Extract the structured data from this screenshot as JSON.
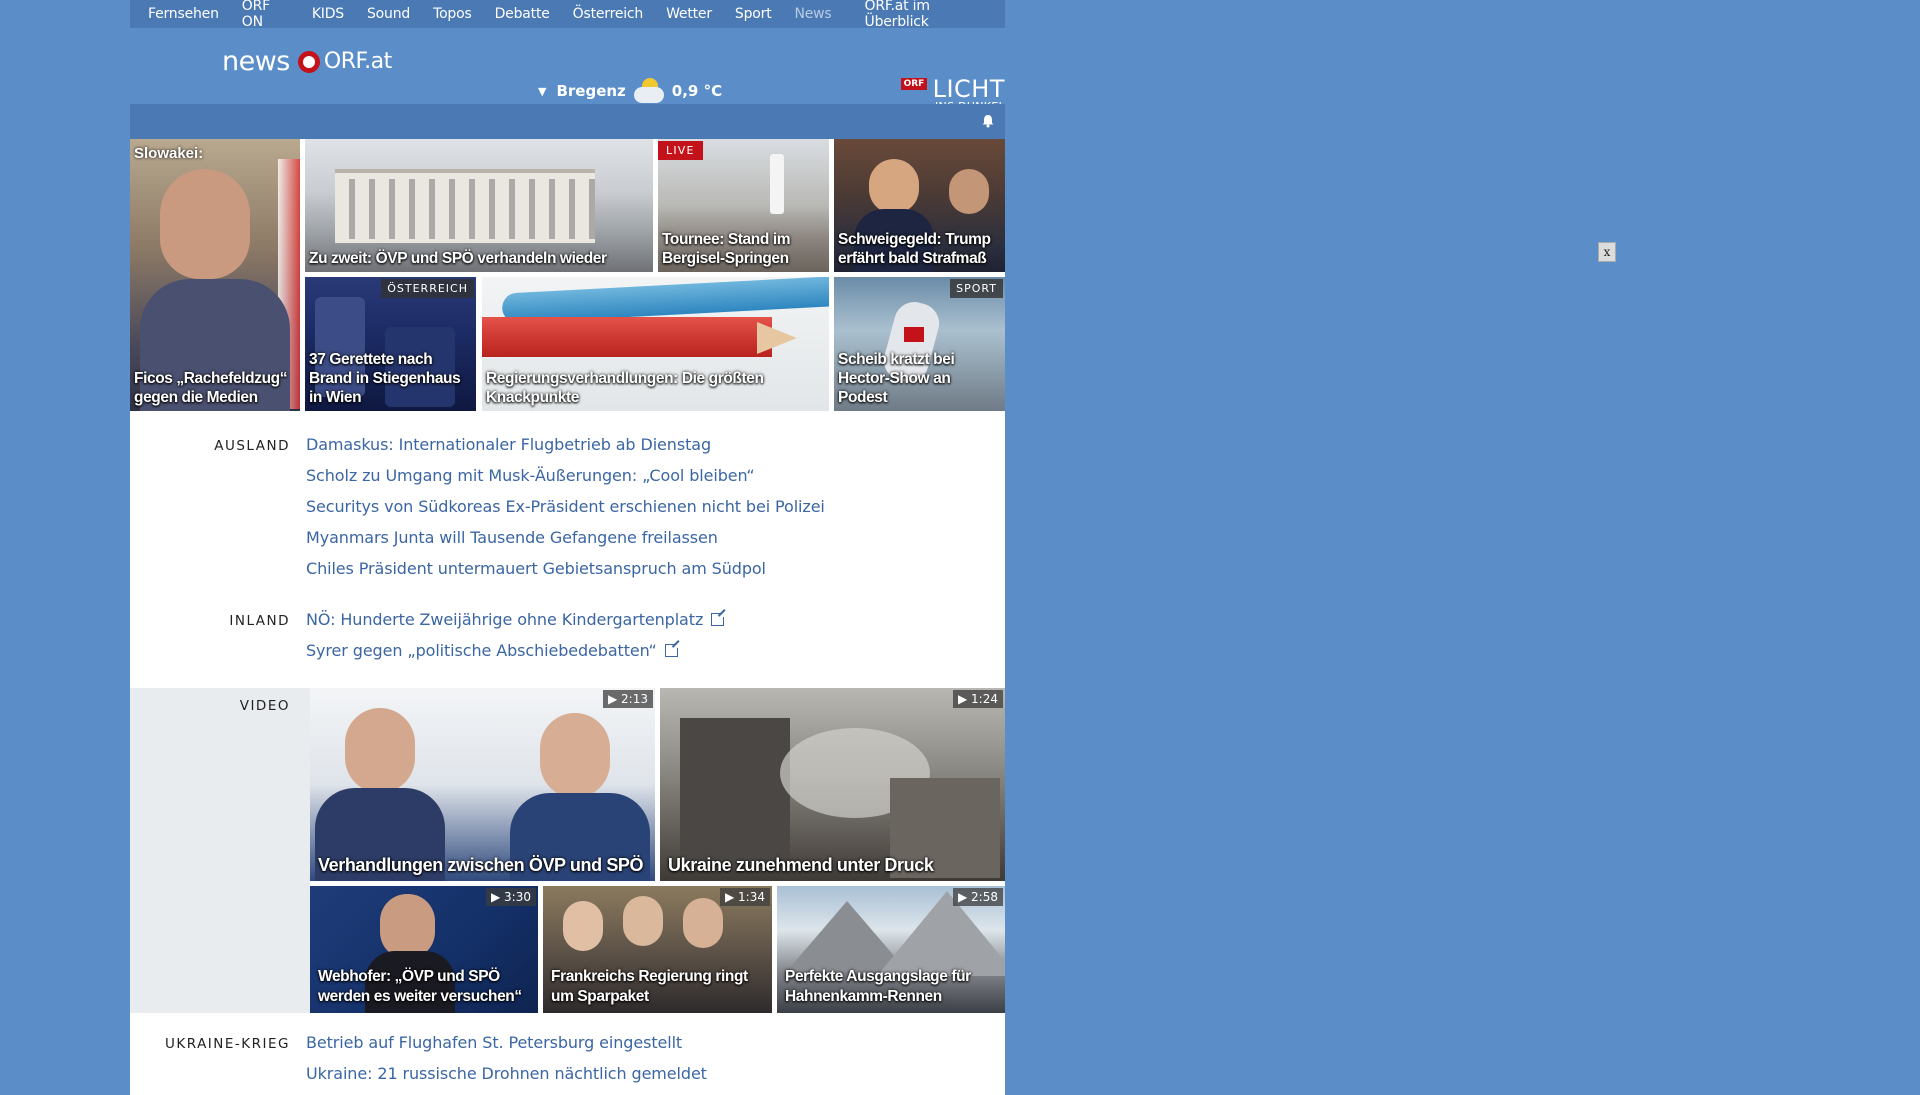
{
  "topnav": {
    "items": [
      "Fernsehen",
      "ORF ON",
      "KIDS",
      "Sound",
      "Topos",
      "Debatte",
      "Österreich",
      "Wetter",
      "Sport",
      "News"
    ],
    "overview": "ORF.at im Überblick"
  },
  "header": {
    "logo_news": "news",
    "logo_orf": "ORF.at",
    "weather_city": "Bregenz",
    "weather_temp": "0,9 °C",
    "licht_badge": "ORF",
    "licht_title": "LICHT",
    "licht_subtitle": "INS DUNKEL"
  },
  "tiles": {
    "slowakei_kicker": "Slowakei:",
    "slowakei_caption": "Ficos „Rachefeldzug“ gegen die Medien",
    "zuzweit_caption": "Zu zweit: ÖVP und SPÖ verhandeln wieder",
    "tournee_live": "LIVE",
    "tournee_caption": "Tournee: Stand im Bergisel-Springen",
    "trump_caption": "Schweigegeld: Trump erfährt bald Strafmaß",
    "brand_tag": "ÖSTERREICH",
    "brand_caption": "37 Gerettete nach Brand in Stiegenhaus in Wien",
    "regierung_caption": "Regierungsverhandlungen: Die größten Knackpunkte",
    "scheib_tag": "SPORT",
    "scheib_caption": "Scheib kratzt bei Hector-Show an Podest"
  },
  "ausland": {
    "label": "AUSLAND",
    "items": [
      "Damaskus: Internationaler Flugbetrieb ab Dienstag",
      "Scholz zu Umgang mit Musk-Äußerungen: „Cool bleiben“",
      "Securitys von Südkoreas Ex-Präsident erschienen nicht bei Polizei",
      "Myanmars Junta will Tausende Gefangene freilassen",
      "Chiles Präsident untermauert Gebietsanspruch am Südpol"
    ]
  },
  "inland": {
    "label": "INLAND",
    "items": [
      "NÖ: Hunderte Zweijährige ohne Kindergartenplatz",
      "Syrer gegen „politische Abschiebedebatten“"
    ]
  },
  "video": {
    "label": "VIDEO",
    "items": [
      {
        "duration": "2:13",
        "caption": "Verhandlungen zwischen ÖVP und SPÖ"
      },
      {
        "duration": "1:24",
        "caption": "Ukraine zunehmend unter Druck"
      },
      {
        "duration": "3:30",
        "caption": "Webhofer: „ÖVP und SPÖ werden es weiter versuchen“"
      },
      {
        "duration": "1:34",
        "caption": "Frankreichs Regierung ringt um Sparpaket"
      },
      {
        "duration": "2:58",
        "caption": "Perfekte Ausgangslage für Hahnenkamm-Rennen"
      }
    ]
  },
  "ukraine": {
    "label": "UKRAINE-KRIEG",
    "items": [
      "Betrieb auf Flughafen St. Petersburg eingestellt",
      "Ukraine: 21 russische Drohnen nächtlich gemeldet"
    ]
  },
  "close_button": "x"
}
